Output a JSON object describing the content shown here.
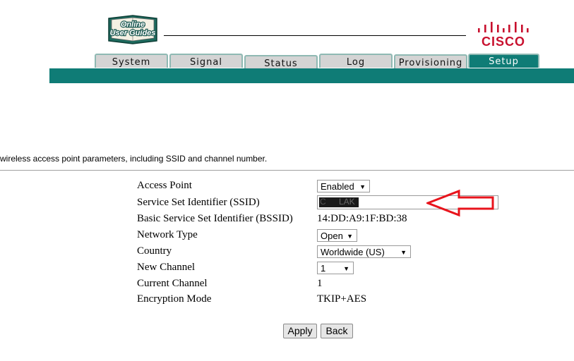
{
  "header": {
    "logo_text": [
      "Online",
      "User Guides"
    ],
    "brand": "CISCO"
  },
  "tabs": [
    {
      "label": "System",
      "active": false
    },
    {
      "label": "Signal",
      "active": false
    },
    {
      "label": "Status",
      "active": false
    },
    {
      "label": "Log",
      "active": false
    },
    {
      "label": "Provisioning",
      "active": false
    },
    {
      "label": "Setup",
      "active": true
    }
  ],
  "description": "wireless access point parameters, including SSID and channel number.",
  "form": {
    "access_point": {
      "label": "Access Point",
      "value": "Enabled"
    },
    "ssid": {
      "label": "Service Set Identifier (SSID)",
      "value_prefix": "C",
      "value_suffix": "LAK"
    },
    "bssid": {
      "label": "Basic Service Set Identifier (BSSID)",
      "value": "14:DD:A9:1F:BD:38"
    },
    "network_type": {
      "label": "Network Type",
      "value": "Open"
    },
    "country": {
      "label": "Country",
      "value": "Worldwide (US)"
    },
    "new_channel": {
      "label": "New Channel",
      "value": "1"
    },
    "current_channel": {
      "label": "Current Channel",
      "value": "1"
    },
    "encryption_mode": {
      "label": "Encryption Mode",
      "value": "TKIP+AES"
    }
  },
  "buttons": {
    "apply": "Apply",
    "back": "Back"
  },
  "colors": {
    "teal": "#0f7c76",
    "cisco_red": "#c8102e",
    "annotation_red": "#e8141c"
  }
}
